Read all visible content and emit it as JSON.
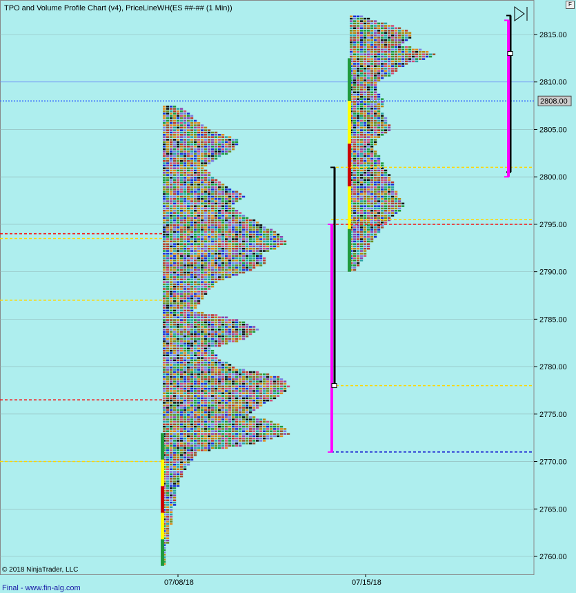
{
  "title": "TPO and Volume Profile Chart (v4), PriceLineWH(ES ##-## (1 Min))",
  "copyright": "© 2018 NinjaTrader, LLC",
  "footer": "Final - www.fin-alg.com",
  "corner_button": "F",
  "colors": {
    "background": "#aeeeee",
    "tpo_palette": [
      "#c0392b",
      "#1c2fd6",
      "#1f9a3c",
      "#b8860b",
      "#8e44ad",
      "#e08a1e",
      "#111111",
      "#2aa3a3",
      "#d24d7a",
      "#6b8e23",
      "#a0522d",
      "#7d7de0"
    ],
    "red_level": "#ff0000",
    "yellow_level": "#ffd700",
    "blue_level": "#0000cc",
    "magenta_range": "#ff00ff",
    "black_range": "#000000",
    "last_price_tag": "#cccccc"
  },
  "chart_data": {
    "type": "tpo_profile",
    "symbol": "ES ##-## (1 Min)",
    "y_axis": {
      "range": [
        2759,
        2817.5
      ],
      "ticks": [
        "2760.00",
        "2765.00",
        "2770.00",
        "2775.00",
        "2780.00",
        "2785.00",
        "2790.00",
        "2795.00",
        "2800.00",
        "2805.00",
        "2810.00",
        "2815.00"
      ]
    },
    "x_axis": {
      "labels": [
        "07/08/18",
        "07/15/18"
      ]
    },
    "last_price": "2808.00",
    "horizontal_lines": [
      {
        "price": 2810.0,
        "style": "solid",
        "color": "#6688ff"
      },
      {
        "price": 2808.0,
        "style": "dotted",
        "color": "#3366ff"
      }
    ],
    "profiles": [
      {
        "period": "07/08/18",
        "low": 2759.0,
        "high": 2807.5,
        "levels": [
          {
            "price": 2794.0,
            "color": "red"
          },
          {
            "price": 2793.5,
            "color": "yellow"
          },
          {
            "price": 2787.0,
            "color": "yellow"
          },
          {
            "price": 2776.5,
            "color": "red"
          },
          {
            "price": 2770.0,
            "color": "yellow"
          }
        ],
        "ranges": [
          {
            "color": "black",
            "low": 2778.0,
            "high": 2801.0
          },
          {
            "color": "magenta",
            "low": 2771.0,
            "high": 2795.0
          }
        ],
        "value_marker": 2778.0,
        "width_at_price": [
          [
            2807.5,
            4
          ],
          [
            2807.0,
            7
          ],
          [
            2806.0,
            10
          ],
          [
            2805.0,
            14
          ],
          [
            2804.0,
            22
          ],
          [
            2803.0,
            21
          ],
          [
            2802.0,
            16
          ],
          [
            2801.0,
            12
          ],
          [
            2800.0,
            15
          ],
          [
            2799.0,
            19
          ],
          [
            2798.0,
            24
          ],
          [
            2797.0,
            20
          ],
          [
            2796.0,
            24
          ],
          [
            2795.0,
            29
          ],
          [
            2794.0,
            34
          ],
          [
            2793.0,
            36
          ],
          [
            2792.0,
            29
          ],
          [
            2791.0,
            30
          ],
          [
            2790.0,
            24
          ],
          [
            2789.0,
            16
          ],
          [
            2788.0,
            13
          ],
          [
            2787.0,
            11
          ],
          [
            2786.0,
            9
          ],
          [
            2785.0,
            22
          ],
          [
            2784.0,
            28
          ],
          [
            2783.0,
            24
          ],
          [
            2782.0,
            14
          ],
          [
            2781.0,
            16
          ],
          [
            2780.0,
            21
          ],
          [
            2779.0,
            34
          ],
          [
            2778.0,
            37
          ],
          [
            2777.0,
            34
          ],
          [
            2776.0,
            29
          ],
          [
            2775.0,
            25
          ],
          [
            2774.0,
            34
          ],
          [
            2773.0,
            37
          ],
          [
            2772.0,
            27
          ],
          [
            2771.0,
            10
          ],
          [
            2770.0,
            8
          ],
          [
            2769.0,
            6
          ],
          [
            2768.0,
            5
          ],
          [
            2767.0,
            4
          ],
          [
            2766.0,
            4
          ],
          [
            2765.0,
            3
          ],
          [
            2764.0,
            3
          ],
          [
            2763.0,
            2
          ],
          [
            2762.0,
            2
          ],
          [
            2761.0,
            1
          ],
          [
            2760.0,
            1
          ],
          [
            2759.0,
            1
          ]
        ]
      },
      {
        "period": "07/15/18",
        "low": 2790.0,
        "high": 2817.0,
        "levels": [
          {
            "price": 2795.0,
            "color": "red"
          },
          {
            "price": 2795.5,
            "color": "yellow"
          },
          {
            "price": 2801.0,
            "color": "yellow"
          },
          {
            "price": 2778.0,
            "color": "yellow"
          },
          {
            "price": 2771.0,
            "color": "blue"
          }
        ],
        "ranges": [
          {
            "color": "black",
            "low": 2800.5,
            "high": 2817.0
          },
          {
            "color": "magenta",
            "low": 2800.0,
            "high": 2816.5
          }
        ],
        "value_marker": 2813.0,
        "width_at_price": [
          [
            2817.0,
            4
          ],
          [
            2816.5,
            8
          ],
          [
            2816.0,
            13
          ],
          [
            2815.5,
            17
          ],
          [
            2815.0,
            18
          ],
          [
            2814.5,
            17
          ],
          [
            2814.0,
            15
          ],
          [
            2813.5,
            21
          ],
          [
            2813.0,
            25
          ],
          [
            2812.5,
            22
          ],
          [
            2812.0,
            17
          ],
          [
            2811.5,
            14
          ],
          [
            2811.0,
            13
          ],
          [
            2810.5,
            10
          ],
          [
            2810.0,
            8
          ],
          [
            2809.0,
            8
          ],
          [
            2808.0,
            10
          ],
          [
            2807.0,
            9
          ],
          [
            2806.0,
            11
          ],
          [
            2805.0,
            12
          ],
          [
            2804.0,
            8
          ],
          [
            2803.0,
            7
          ],
          [
            2802.0,
            9
          ],
          [
            2801.0,
            10
          ],
          [
            2800.0,
            12
          ],
          [
            2799.0,
            13
          ],
          [
            2798.0,
            14
          ],
          [
            2797.0,
            16
          ],
          [
            2796.0,
            13
          ],
          [
            2795.0,
            10
          ],
          [
            2794.0,
            8
          ],
          [
            2793.0,
            6
          ],
          [
            2792.0,
            5
          ],
          [
            2791.0,
            3
          ],
          [
            2790.0,
            1
          ]
        ]
      }
    ]
  }
}
